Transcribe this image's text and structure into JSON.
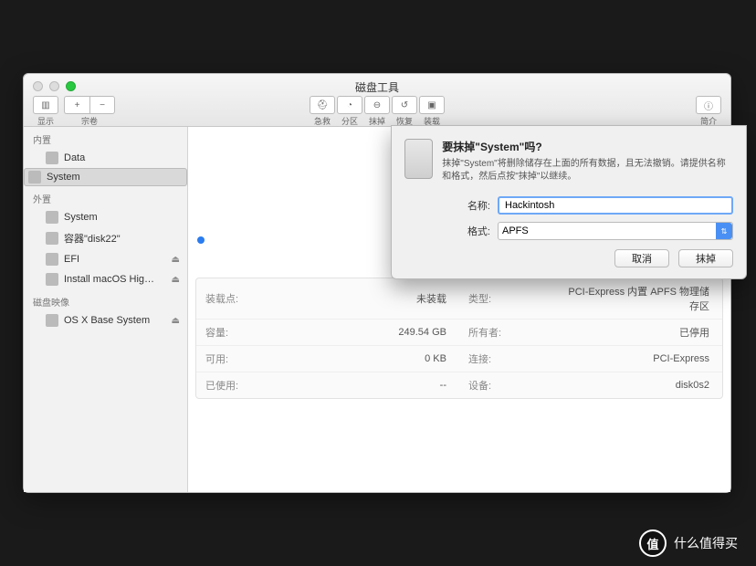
{
  "window": {
    "title": "磁盘工具"
  },
  "toolbar": {
    "left": [
      {
        "label": "显示",
        "icon": "view"
      },
      {
        "label": "宗卷",
        "icon": "volume"
      }
    ],
    "center": [
      {
        "label": "急救"
      },
      {
        "label": "分区"
      },
      {
        "label": "抹掉"
      },
      {
        "label": "恢复"
      },
      {
        "label": "装载"
      }
    ],
    "right": {
      "label": "简介"
    }
  },
  "sidebar": {
    "sections": [
      {
        "header": "内置",
        "items": [
          {
            "label": "Data",
            "selected": false
          },
          {
            "label": "System",
            "selected": true
          }
        ]
      },
      {
        "header": "外置",
        "items": [
          {
            "label": "System",
            "eject": false
          },
          {
            "label": "容器\"disk22\"",
            "eject": false
          },
          {
            "label": "EFI",
            "eject": true
          },
          {
            "label": "Install macOS Hig…",
            "eject": true
          }
        ]
      },
      {
        "header": "磁盘映像",
        "items": [
          {
            "label": "OS X Base System",
            "eject": true
          }
        ]
      }
    ]
  },
  "main": {
    "size": "249.54 GB",
    "info_rows": [
      {
        "k1": "装载点:",
        "v1": "未装载",
        "k2": "类型:",
        "v2": "PCI-Express 内置 APFS 物理储存区"
      },
      {
        "k1": "容量:",
        "v1": "249.54 GB",
        "k2": "所有者:",
        "v2": "已停用"
      },
      {
        "k1": "可用:",
        "v1": "0 KB",
        "k2": "连接:",
        "v2": "PCI-Express"
      },
      {
        "k1": "已使用:",
        "v1": "--",
        "k2": "设备:",
        "v2": "disk0s2"
      }
    ]
  },
  "modal": {
    "title": "要抹掉\"System\"吗?",
    "message": "抹掉\"System\"将删除储存在上面的所有数据，且无法撤销。请提供名称和格式，然后点按\"抹掉\"以继续。",
    "name_label": "名称:",
    "name_value": "Hackintosh",
    "format_label": "格式:",
    "format_value": "APFS",
    "cancel": "取消",
    "confirm": "抹掉"
  },
  "brand": {
    "char": "值",
    "text": "什么值得买"
  }
}
